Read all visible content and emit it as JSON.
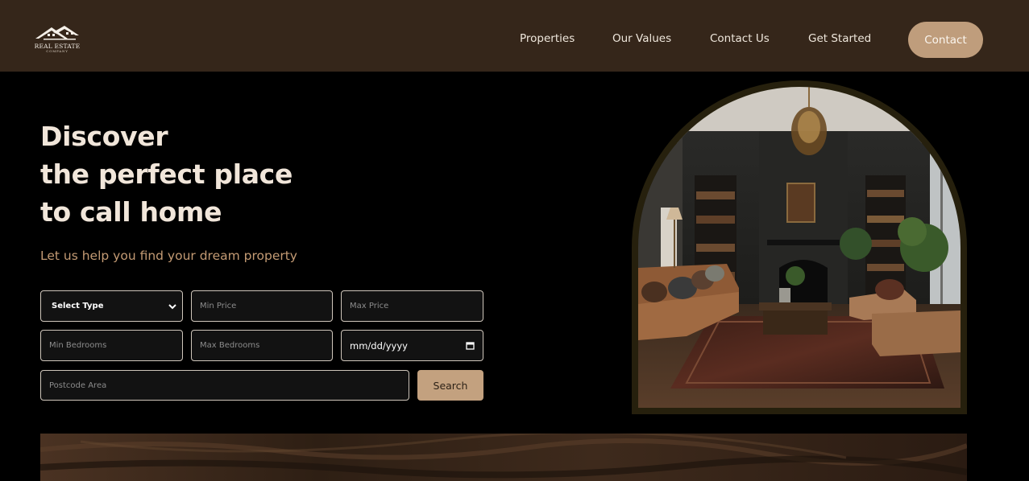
{
  "brand": {
    "name": "REAL ESTATE",
    "tagline": "COMPANY",
    "logo_icon": "house-roof-icon"
  },
  "nav": {
    "links": [
      "Properties",
      "Our Values",
      "Contact Us",
      "Get Started"
    ],
    "contact_label": "Contact"
  },
  "hero": {
    "title_lines": [
      "Discover",
      "the perfect place",
      "to call home"
    ],
    "subtitle": "Let us help you find your dream property"
  },
  "search_form": {
    "type_select": {
      "selected": "Select Type",
      "icon": "chevron-down-icon"
    },
    "min_price_placeholder": "Min Price",
    "max_price_placeholder": "Max Price",
    "min_bedrooms_placeholder": "Min Bedrooms",
    "max_bedrooms_placeholder": "Max Bedrooms",
    "date_value": "mm/dd/yyyy",
    "date_icon": "calendar-icon",
    "postcode_placeholder": "Postcode Area",
    "search_label": "Search"
  },
  "colors": {
    "header_bg": "#35261a",
    "accent": "#c3a17f",
    "title": "#f1e6da",
    "subtitle": "#c49b74",
    "arch_border": "#26200d"
  }
}
